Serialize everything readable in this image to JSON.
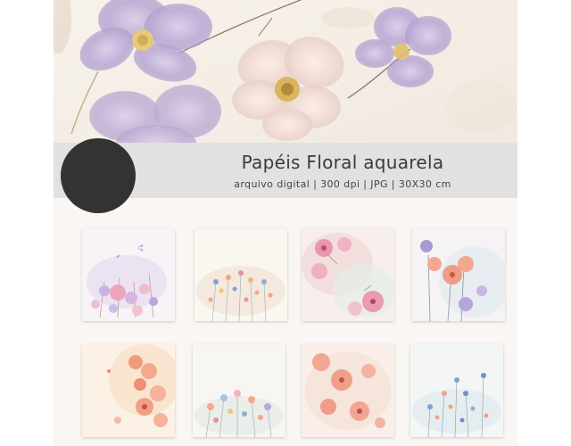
{
  "header": {
    "title": "Papéis Floral aquarela",
    "subtitle": "arquivo digital | 300 dpi | JPG | 30X30 cm"
  },
  "palette": {
    "band": "#e1e1e1",
    "badge": "#333333",
    "background": "#f9f6f3",
    "lavender": "#b7a6d3",
    "peach": "#f0a58c",
    "pink": "#e58ea8",
    "blue": "#8fb0d4"
  },
  "gallery": {
    "tiles": [
      {
        "name": "tile-lilac-butterfly-meadow",
        "theme": "lilac"
      },
      {
        "name": "tile-wildflower-dots",
        "theme": "dots"
      },
      {
        "name": "tile-pink-blossoms",
        "theme": "pink"
      },
      {
        "name": "tile-coral-lavender-flowers",
        "theme": "coral"
      },
      {
        "name": "tile-peach-floral-corner",
        "theme": "peach"
      },
      {
        "name": "tile-pastel-meadow",
        "theme": "meadow"
      },
      {
        "name": "tile-peach-rose-blossoms",
        "theme": "rose"
      },
      {
        "name": "tile-blue-wildflowers",
        "theme": "blue"
      }
    ]
  }
}
